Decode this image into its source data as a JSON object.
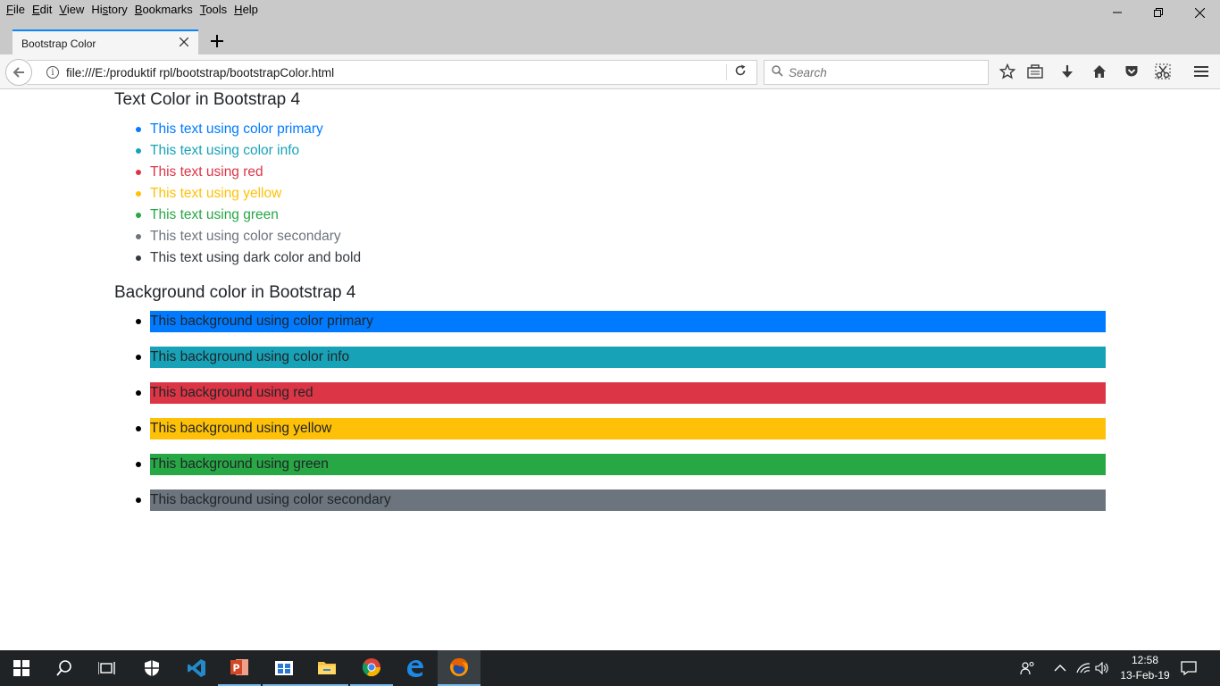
{
  "menu": {
    "file": {
      "acc": "F",
      "rest": "ile"
    },
    "edit": {
      "acc": "E",
      "rest": "dit"
    },
    "view": {
      "acc": "V",
      "rest": "iew"
    },
    "history": {
      "pre": "Hi",
      "acc": "s",
      "rest": "tory"
    },
    "bookmarks": {
      "acc": "B",
      "rest": "ookmarks"
    },
    "tools": {
      "acc": "T",
      "rest": "ools"
    },
    "help": {
      "acc": "H",
      "rest": "elp"
    }
  },
  "tab": {
    "title": "Bootstrap Color"
  },
  "urlbar": {
    "url": "file:///E:/produktif rpl/bootstrap/bootstrapColor.html"
  },
  "search": {
    "placeholder": "Search"
  },
  "page": {
    "text_heading": "Text Color in Bootstrap 4",
    "text_items": [
      {
        "label": "This text using color primary",
        "color": "#007bff"
      },
      {
        "label": "This text using color info",
        "color": "#17a2b8"
      },
      {
        "label": "This text using red",
        "color": "#dc3545"
      },
      {
        "label": "This text using yellow",
        "color": "#ffc107"
      },
      {
        "label": "This text using green",
        "color": "#28a745"
      },
      {
        "label": "This text using color secondary",
        "color": "#6c757d"
      },
      {
        "label": "This text using dark color and bold",
        "color": "#343a40"
      }
    ],
    "bg_heading": "Background color in Bootstrap 4",
    "bg_items": [
      {
        "label": "This background using color primary",
        "color": "#007bff"
      },
      {
        "label": "This background using color info",
        "color": "#17a2b8"
      },
      {
        "label": "This background using red",
        "color": "#dc3545"
      },
      {
        "label": "This background using yellow",
        "color": "#ffc107"
      },
      {
        "label": "This background using green",
        "color": "#28a745"
      },
      {
        "label": "This background using color secondary",
        "color": "#6c757d"
      }
    ]
  },
  "taskbar": {
    "time": "12:58",
    "date": "13-Feb-19",
    "apps": [
      "start-icon",
      "search-icon",
      "task-view-icon",
      "defender-icon",
      "vscode-icon",
      "powerpoint-icon",
      "store-icon",
      "file-explorer-icon",
      "chrome-icon",
      "edge-icon",
      "firefox-icon"
    ]
  }
}
